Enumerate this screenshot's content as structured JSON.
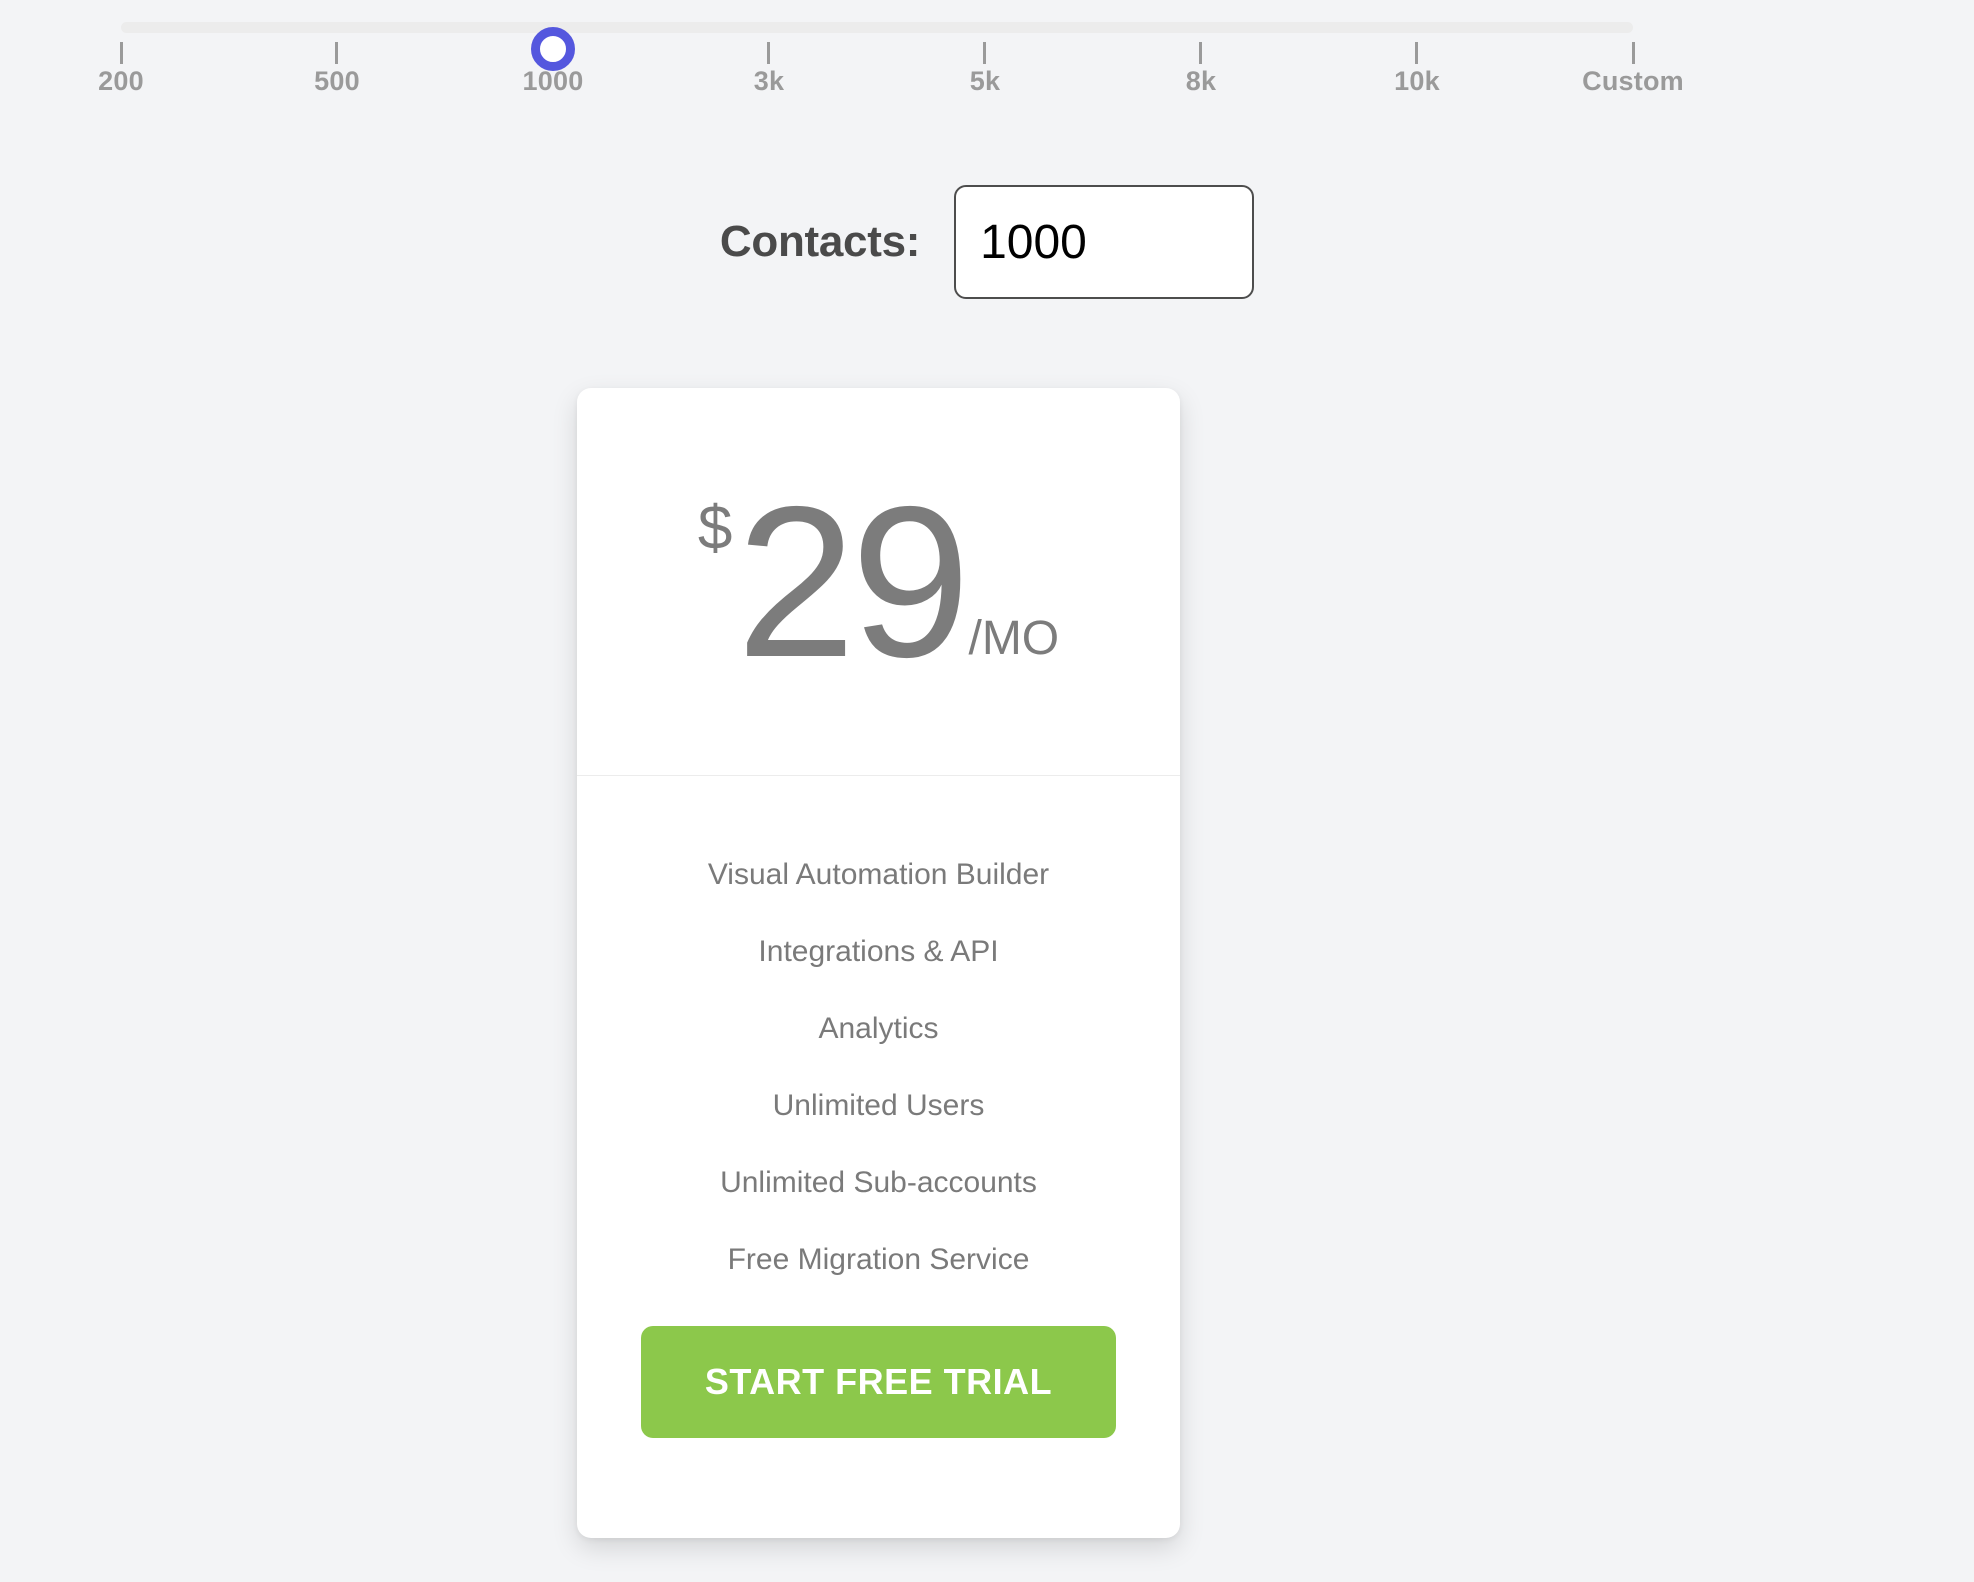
{
  "colors": {
    "page_background": "#F3F4F6",
    "slider_track": "#ECECEC",
    "slider_handle_accent": "#5457DE",
    "tick_gray": "#9A9A9A",
    "price_gray": "#7C7C7C",
    "feature_gray": "#7A7A7A",
    "cta_green": "#8CC84B",
    "input_border": "#4D4D4D"
  },
  "slider": {
    "name": "contacts-slider",
    "selected_value": "1000",
    "selected_index": 2,
    "ticks": [
      {
        "label": "200",
        "value": 200,
        "pos_pct": 0
      },
      {
        "label": "500",
        "value": 500,
        "pos_pct": 14.2857
      },
      {
        "label": "1000",
        "value": 1000,
        "pos_pct": 28.5714
      },
      {
        "label": "3k",
        "value": 3000,
        "pos_pct": 42.8571
      },
      {
        "label": "5k",
        "value": 5000,
        "pos_pct": 57.1428
      },
      {
        "label": "8k",
        "value": 8000,
        "pos_pct": 71.4285
      },
      {
        "label": "10k",
        "value": 10000,
        "pos_pct": 85.7142
      },
      {
        "label": "Custom",
        "value": null,
        "pos_pct": 100
      }
    ]
  },
  "contacts": {
    "label": "Contacts:",
    "value": "1000",
    "placeholder": "1000"
  },
  "plan": {
    "price": {
      "currency": "$",
      "amount": "29",
      "period": "/MO"
    },
    "features": [
      "Visual Automation Builder",
      "Integrations & API",
      "Analytics",
      "Unlimited Users",
      "Unlimited Sub-accounts",
      "Free Migration Service"
    ],
    "cta_label": "START FREE TRIAL"
  }
}
